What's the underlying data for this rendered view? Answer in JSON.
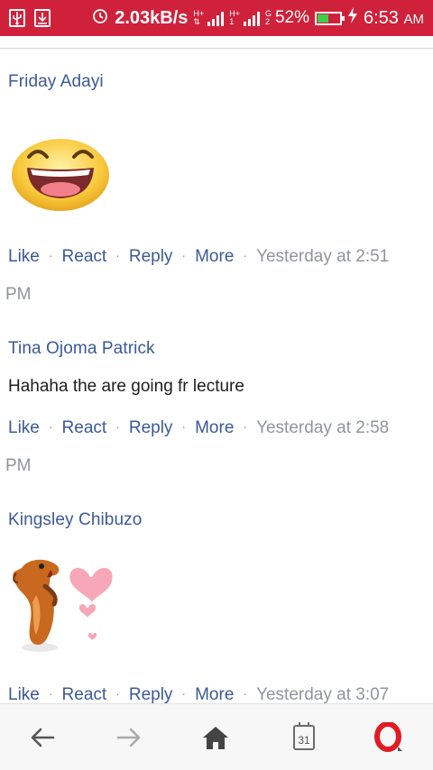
{
  "status_bar": {
    "speed": "2.03kB/s",
    "net1_top": "H+",
    "net1_sub": "",
    "net2_top": "H+",
    "net2_sub": "1",
    "net3_top": "G",
    "net3_sub": "2",
    "battery": "52%",
    "battery_level": 0.52,
    "time": "6:53",
    "ampm": "AM",
    "icons": [
      "usb-icon",
      "download-icon",
      "alarm-icon",
      "signal-icon",
      "battery-icon",
      "charging-icon"
    ]
  },
  "comments": [
    {
      "author": "Friday Adayi",
      "sticker": "laughing-face-sticker",
      "actions": {
        "like": "Like",
        "react": "React",
        "reply": "Reply",
        "more": "More"
      },
      "time_line1": "Yesterday  at 2:51",
      "time_line2": "PM"
    },
    {
      "author": "Tina Ojoma Patrick",
      "text": "Hahaha the are going fr lecture",
      "actions": {
        "like": "Like",
        "react": "React",
        "reply": "Reply",
        "more": "More"
      },
      "time_line1": "Yesterday  at 2:58",
      "time_line2": "PM"
    },
    {
      "author": "Kingsley Chibuzo",
      "sticker": "meerkat-hearts-sticker",
      "actions": {
        "like": "Like",
        "react": "React",
        "reply": "Reply",
        "more": "More"
      },
      "time_line1": "Yesterday  at 3:07"
    }
  ],
  "separator": "·",
  "bottom_nav": {
    "tabs_count": "31",
    "icons": [
      "back-arrow-icon",
      "forward-arrow-icon",
      "home-icon",
      "tabs-icon",
      "opera-icon"
    ]
  },
  "colors": {
    "status_bar": "#d0213b",
    "link": "#3b5998",
    "meta": "#90949c",
    "opera": "#e01b24"
  }
}
